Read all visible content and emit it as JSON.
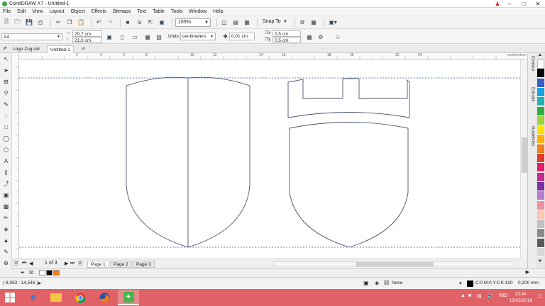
{
  "window": {
    "title": "CorelDRAW X7 - Untitled-1"
  },
  "menu": [
    "File",
    "Edit",
    "View",
    "Layout",
    "Object",
    "Effects",
    "Bitmaps",
    "Text",
    "Table",
    "Tools",
    "Window",
    "Help"
  ],
  "toolbar": {
    "zoom": "155%",
    "snap_to": "Snap To"
  },
  "property_bar": {
    "page_size": "A4",
    "width": "29,7 cm",
    "height": "21,0 cm",
    "units_label": "Units:",
    "units": "centimeters",
    "nudge": "0,01 cm",
    "dup_x": "0,5 cm",
    "dup_y": "0,5 cm"
  },
  "document_tabs": [
    "Logo Zug.cdr",
    "Untitled-1"
  ],
  "ruler": {
    "top_numbers": [
      "2",
      "4",
      "6",
      "8",
      "10",
      "12",
      "14",
      "16",
      "18",
      "20",
      "22",
      "24"
    ],
    "units_label": "centimeters"
  },
  "dockers": [
    "Contour",
    "Extrude",
    "Guidelines"
  ],
  "pages": {
    "counter": "1 of 3",
    "tabs": [
      "Page 1",
      "Page 2",
      "Page 3"
    ],
    "active_index": 0
  },
  "status": {
    "coordinates": "( 8,053 ; 14,546 )",
    "fill": "None",
    "outline_color": "C:0 M:0 Y:0 K:100",
    "outline_width": "0,200 mm"
  },
  "taskbar": {
    "language": "IND",
    "time": "23:44",
    "date": "15/03/2018"
  },
  "palette_colors": [
    "#ffffff",
    "#000000",
    "#3a5cc7",
    "#1aa3e0",
    "#1fb5b0",
    "#2fae3c",
    "#9cd33a",
    "#ffe400",
    "#ffb000",
    "#f07f1a",
    "#e03a2a",
    "#e31c6b",
    "#c22a8f",
    "#7b2fa0",
    "#b87ad0",
    "#f08fa0",
    "#fcc6b0",
    "#c0c0c0",
    "#8a8a8a",
    "#5a5a5a",
    "#d9d9d9"
  ],
  "doc_palette_colors": [
    "#ffffff",
    "#000000",
    "#f07f1a"
  ]
}
